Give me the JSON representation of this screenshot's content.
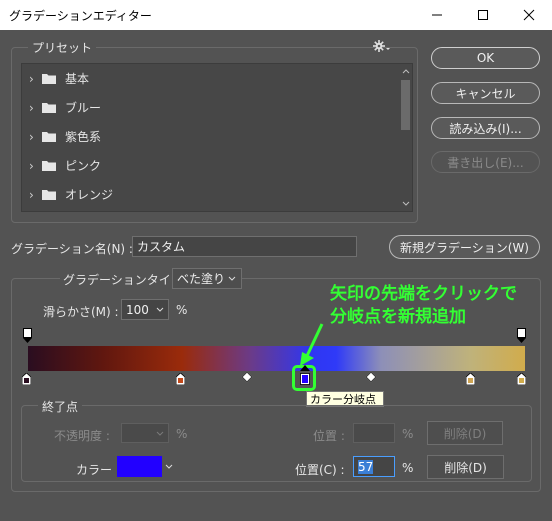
{
  "window": {
    "title": "グラデーションエディター"
  },
  "presets": {
    "legend": "プリセット",
    "items": [
      {
        "label": "基本"
      },
      {
        "label": "ブルー"
      },
      {
        "label": "紫色系"
      },
      {
        "label": "ピンク"
      },
      {
        "label": "オレンジ"
      }
    ]
  },
  "buttons": {
    "ok": "OK",
    "cancel": "キャンセル",
    "load": "読み込み(I)...",
    "save": "書き出し(E)...",
    "new_gradient": "新規グラデーション(W)"
  },
  "name": {
    "label": "グラデーション名(N) :",
    "value": "カスタム"
  },
  "type": {
    "label": "グラデーションタイプ :",
    "value": "べた塗り"
  },
  "smoothness": {
    "label": "滑らかさ(M) :",
    "value": "100",
    "unit": "%"
  },
  "annotation": {
    "line1": "矢印の先端をクリックで",
    "line2": "分岐点を新規追加",
    "color": "#33ff33"
  },
  "tooltip": "カラー分岐点",
  "stops": {
    "legend": "終了点",
    "opacity_label": "不透明度 :",
    "opacity_unit": "%",
    "opacity_position_label": "位置 :",
    "opacity_position_unit": "%",
    "opacity_delete": "削除(D)",
    "color_label": "カラー :",
    "color_value": "#2200ff",
    "position_label": "位置(C) :",
    "position_value": "57",
    "position_unit": "%",
    "delete": "削除(D)"
  }
}
